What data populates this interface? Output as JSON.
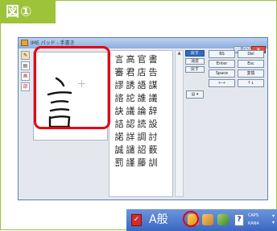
{
  "figure_label": "図①",
  "window": {
    "title": "IME パッド - 手書き"
  },
  "tool_buttons": [
    "✎",
    "▤",
    "画",
    "部"
  ],
  "candidates": [
    "言",
    "高",
    "官",
    "書",
    "審",
    "君",
    "店",
    "告",
    "謬",
    "誘",
    "語",
    "謀",
    "諮",
    "詑",
    "誰",
    "議",
    "訣",
    "議",
    "論",
    "辞",
    "詰",
    "認",
    "読",
    "設",
    "諾",
    "詳",
    "調",
    "討",
    "誠",
    "譴",
    "詔",
    "薮",
    "罰",
    "謹",
    "藤",
    "訓"
  ],
  "mid_buttons": [
    "戻す",
    "消去",
    "戻す",
    "消去"
  ],
  "mid_dropdown": "▤ ▾",
  "keypad": [
    "BS",
    "Del",
    "Enter",
    "Esc",
    "Space",
    "変換",
    "←→",
    "↑↓"
  ],
  "taskbar": {
    "text": "A般",
    "help": "?",
    "caps": "CAPS",
    "kana": "KANA"
  }
}
